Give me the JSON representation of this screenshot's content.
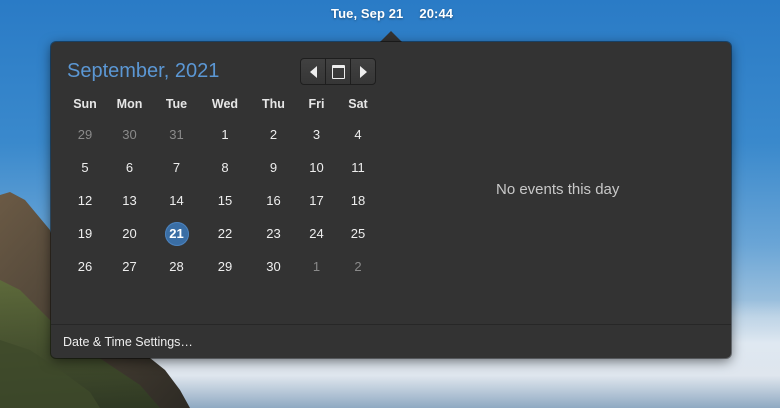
{
  "panel": {
    "date": "Tue, Sep 21",
    "time": "20:44"
  },
  "calendar": {
    "month_title": "September, 2021",
    "nav": {
      "prev_icon": "chevron-left-icon",
      "today_icon": "calendar-icon",
      "next_icon": "chevron-right-icon"
    },
    "weekdays": [
      "Sun",
      "Mon",
      "Tue",
      "Wed",
      "Thu",
      "Fri",
      "Sat"
    ],
    "weeks": [
      [
        {
          "d": "29",
          "other": true
        },
        {
          "d": "30",
          "other": true
        },
        {
          "d": "31",
          "other": true
        },
        {
          "d": "1"
        },
        {
          "d": "2"
        },
        {
          "d": "3"
        },
        {
          "d": "4"
        }
      ],
      [
        {
          "d": "5"
        },
        {
          "d": "6"
        },
        {
          "d": "7"
        },
        {
          "d": "8"
        },
        {
          "d": "9"
        },
        {
          "d": "10"
        },
        {
          "d": "11"
        }
      ],
      [
        {
          "d": "12"
        },
        {
          "d": "13"
        },
        {
          "d": "14"
        },
        {
          "d": "15"
        },
        {
          "d": "16"
        },
        {
          "d": "17"
        },
        {
          "d": "18"
        }
      ],
      [
        {
          "d": "19"
        },
        {
          "d": "20"
        },
        {
          "d": "21",
          "today": true
        },
        {
          "d": "22"
        },
        {
          "d": "23"
        },
        {
          "d": "24"
        },
        {
          "d": "25"
        }
      ],
      [
        {
          "d": "26"
        },
        {
          "d": "27"
        },
        {
          "d": "28"
        },
        {
          "d": "29"
        },
        {
          "d": "30"
        },
        {
          "d": "1",
          "other": true
        },
        {
          "d": "2",
          "other": true
        }
      ]
    ],
    "today_color": "#3a6ea5",
    "title_color": "#5b97d4"
  },
  "events": {
    "empty_text": "No events this day"
  },
  "footer": {
    "settings_label": "Date & Time Settings…"
  }
}
